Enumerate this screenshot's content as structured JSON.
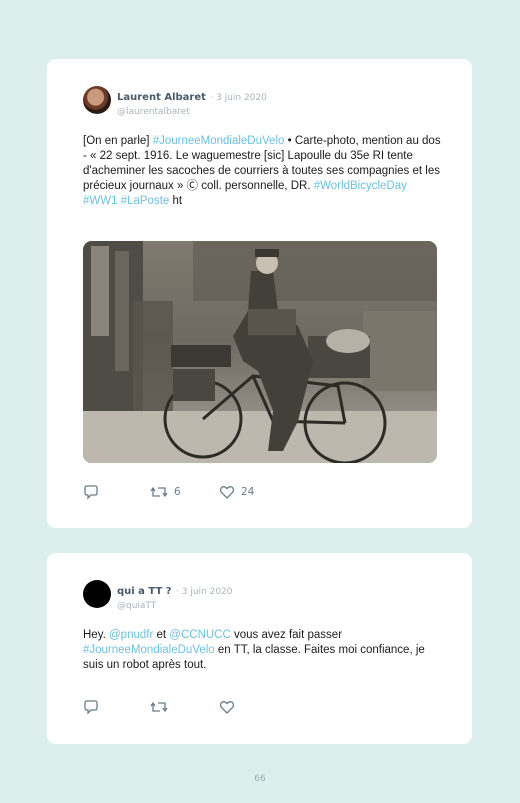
{
  "tweets": [
    {
      "author_name": "Laurent Albaret",
      "date": "· 3 juin 2020",
      "handle": "@laurentalbaret",
      "segments": [
        {
          "t": "[On en parle] ",
          "tag": false
        },
        {
          "t": "#JourneeMondialeDuVelo",
          "tag": true
        },
        {
          "t": " • Carte-photo, mention au dos - « 22 sept. 1916. Le waguemestre [sic] Lapoulle du 35e RI tente d'acheminer les sacoches de courriers à toutes ses compagnies et les précieux journaux » Ⓒ coll. personnelle, DR. ",
          "tag": false
        },
        {
          "t": "#WorldBicycleDay",
          "tag": true
        },
        {
          "t": " ",
          "tag": false
        },
        {
          "t": "#WW1",
          "tag": true
        },
        {
          "t": " ",
          "tag": false
        },
        {
          "t": "#LaPoste",
          "tag": true
        },
        {
          "t": " ht",
          "tag": false
        }
      ],
      "retweets": "6",
      "likes": "24"
    },
    {
      "author_name": "qui a TT ?",
      "date": "· 3 juin 2020",
      "handle": "@quiaTT",
      "segments": [
        {
          "t": "Hey. ",
          "tag": false
        },
        {
          "t": "@pnudfr",
          "tag": true
        },
        {
          "t": " et ",
          "tag": false
        },
        {
          "t": "@CCNUCC",
          "tag": true
        },
        {
          "t": " vous avez fait passer ",
          "tag": false
        },
        {
          "t": "#JourneeMondialeDuVelo",
          "tag": true
        },
        {
          "t": " en TT, la classe. Faites moi confiance, je suis un robot après tout.",
          "tag": false
        }
      ],
      "retweets": "",
      "likes": ""
    }
  ],
  "page_number": "66",
  "colors": {
    "background": "#dcefed",
    "link": "#6cc0e0",
    "icon": "#6a7c88"
  }
}
